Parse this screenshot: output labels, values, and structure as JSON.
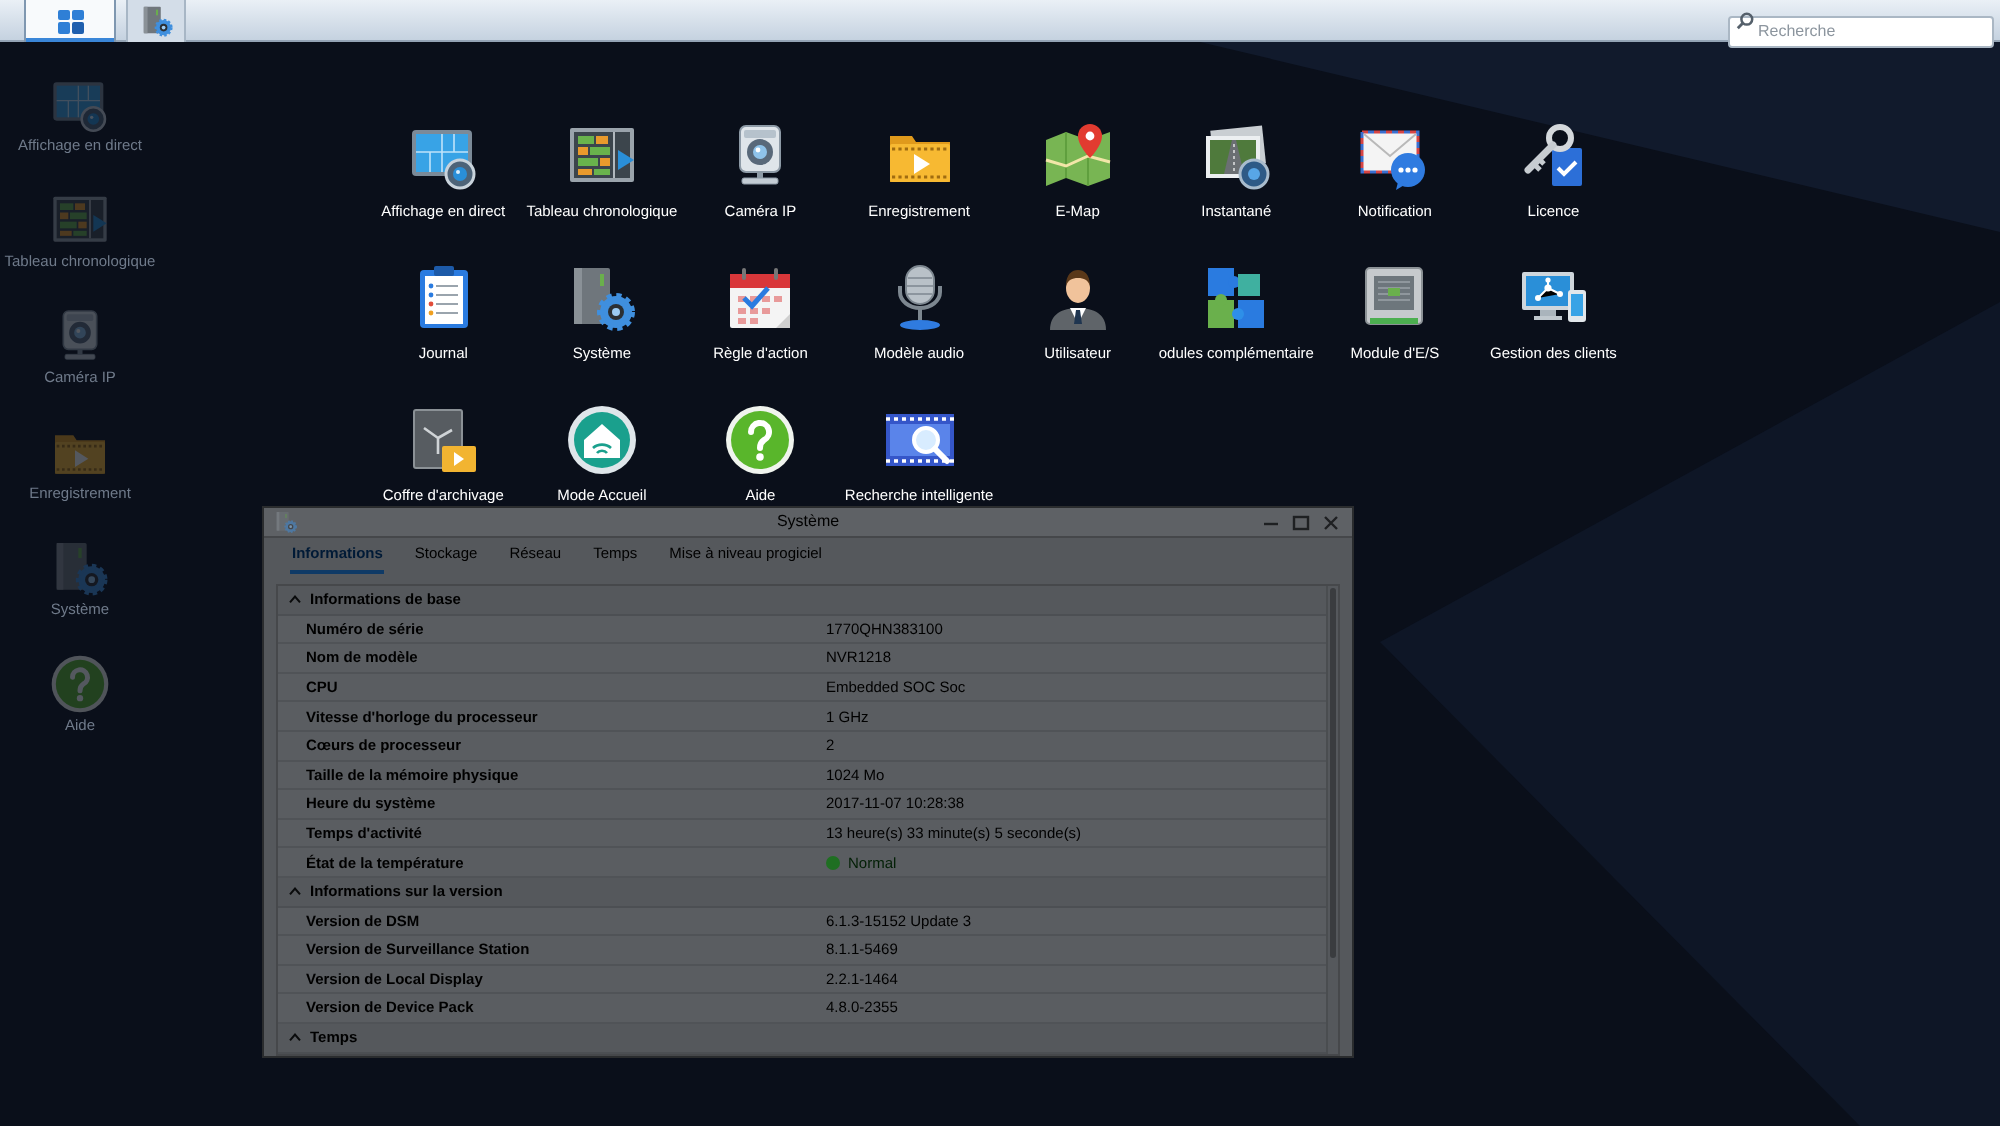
{
  "taskbar": {
    "buttons": [
      {
        "kind": "main-menu",
        "selected": true
      },
      {
        "kind": "system",
        "selected": false
      }
    ],
    "search": {
      "placeholder": "Recherche"
    }
  },
  "desktop": [
    {
      "label": "Affichage en direct",
      "kind": "live-view"
    },
    {
      "label": "Tableau chronologique",
      "kind": "timeline"
    },
    {
      "label": "Caméra IP",
      "kind": "ip-camera"
    },
    {
      "label": "Enregistrement",
      "kind": "recording"
    },
    {
      "label": "Système",
      "kind": "system"
    },
    {
      "label": "Aide",
      "kind": "help"
    }
  ],
  "main_menu": [
    {
      "label": "Affichage en direct",
      "kind": "live-view"
    },
    {
      "label": "Tableau chronologique",
      "kind": "timeline"
    },
    {
      "label": "Caméra IP",
      "kind": "ip-camera"
    },
    {
      "label": "Enregistrement",
      "kind": "recording"
    },
    {
      "label": "E-Map",
      "kind": "emap"
    },
    {
      "label": "Instantané",
      "kind": "snapshot"
    },
    {
      "label": "Notification",
      "kind": "notification"
    },
    {
      "label": "Licence",
      "kind": "license"
    },
    {
      "label": "Journal",
      "kind": "log"
    },
    {
      "label": "Système",
      "kind": "system"
    },
    {
      "label": "Règle d'action",
      "kind": "action-rule"
    },
    {
      "label": "Modèle audio",
      "kind": "audio"
    },
    {
      "label": "Utilisateur",
      "kind": "user"
    },
    {
      "label": "odules complémentaire",
      "kind": "addons"
    },
    {
      "label": "Module d'E/S",
      "kind": "io-module"
    },
    {
      "label": "Gestion des clients",
      "kind": "cms"
    },
    {
      "label": "Coffre d'archivage",
      "kind": "archive"
    },
    {
      "label": "Mode Accueil",
      "kind": "home-mode"
    },
    {
      "label": "Aide",
      "kind": "help"
    },
    {
      "label": "Recherche intelligente",
      "kind": "smart-search"
    }
  ],
  "window": {
    "title": "Système",
    "tabs": [
      {
        "label": "Informations",
        "selected": true
      },
      {
        "label": "Stockage",
        "selected": false
      },
      {
        "label": "Réseau",
        "selected": false
      },
      {
        "label": "Temps",
        "selected": false
      },
      {
        "label": "Mise à niveau progiciel",
        "selected": false
      }
    ],
    "sections": [
      {
        "title": "Informations de base",
        "expanded": true,
        "rows": [
          {
            "label": "Numéro de série",
            "value": "1770QHN383100"
          },
          {
            "label": "Nom de modèle",
            "value": "NVR1218"
          },
          {
            "label": "CPU",
            "value": "Embedded SOC Soc"
          },
          {
            "label": "Vitesse d'horloge du processeur",
            "value": "1 GHz"
          },
          {
            "label": "Cœurs de processeur",
            "value": "2"
          },
          {
            "label": "Taille de la mémoire physique",
            "value": "1024 Mo"
          },
          {
            "label": "Heure du système",
            "value": "2017-11-07 10:28:38"
          },
          {
            "label": "Temps d'activité",
            "value": "13 heure(s) 33 minute(s) 5 seconde(s)"
          },
          {
            "label": "État de la température",
            "value": "Normal",
            "color": "#1f6f22"
          }
        ]
      },
      {
        "title": "Informations sur la version",
        "expanded": true,
        "rows": [
          {
            "label": "Version de DSM",
            "value": "6.1.3-15152 Update 3"
          },
          {
            "label": "Version de Surveillance Station",
            "value": "8.1.1-5469"
          },
          {
            "label": "Version de Local Display",
            "value": "2.2.1-1464"
          },
          {
            "label": "Version de Device Pack",
            "value": "4.8.0-2355"
          }
        ]
      },
      {
        "title": "Temps",
        "expanded": true
      }
    ]
  }
}
